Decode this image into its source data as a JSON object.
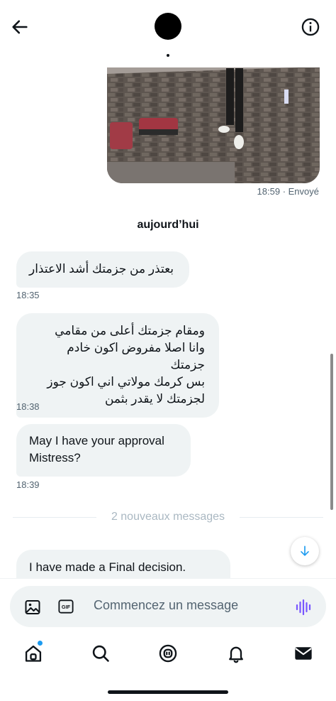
{
  "header": {
    "back_icon": "arrow-left-icon",
    "info_icon": "info-icon"
  },
  "media_message": {
    "time": "18:59",
    "status": "· Envoyé"
  },
  "date_separator": "aujourd’hui",
  "messages": [
    {
      "text": "بعتذر من جزمتك أشد الاعتذار",
      "time": "18:35",
      "dir": "rtl"
    },
    {
      "lines": [
        "ومقام جزمتك أعلى من مقامي",
        "وانا اصلا مفروض اكون خادم جزمتك",
        "بس كرمك مولاتي اني  اكون جوز",
        "لجزمتك لا يقدر بثمن"
      ],
      "time": "18:38",
      "dir": "rtl"
    },
    {
      "lines": [
        "May I have your approval",
        "Mistress?"
      ],
      "time": "18:39",
      "dir": "ltr"
    },
    {
      "text": "I have made a Final decision.",
      "dir": "ltr"
    }
  ],
  "new_messages_label": "2 nouveaux messages",
  "composer": {
    "placeholder": "Commencez un message",
    "icons": [
      "image-icon",
      "gif-icon",
      "voice-icon"
    ]
  },
  "tabbar": {
    "items": [
      "home-icon",
      "search-icon",
      "grok-icon",
      "notifications-icon",
      "messages-icon"
    ]
  },
  "colors": {
    "accent": "#1d9bf0",
    "bubble": "#eff3f4",
    "voice": "#7856ff"
  }
}
